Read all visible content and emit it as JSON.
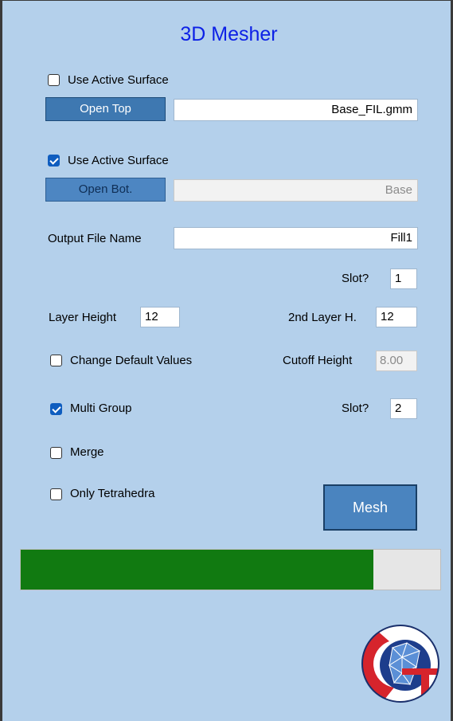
{
  "title": "3D Mesher",
  "top_surface": {
    "use_active_label": "Use Active Surface",
    "use_active_checked": false,
    "open_button": "Open Top",
    "file_value": "Base_FIL.gmm"
  },
  "bottom_surface": {
    "use_active_label": "Use Active Surface",
    "use_active_checked": true,
    "open_button": "Open Bot.",
    "file_value": "Base"
  },
  "output": {
    "label": "Output File Name",
    "value": "Fill1",
    "slot_label": "Slot?",
    "slot_value": "1"
  },
  "layers": {
    "layer_height_label": "Layer Height",
    "layer_height_value": "12",
    "second_layer_label": "2nd Layer H.",
    "second_layer_value": "12"
  },
  "defaults": {
    "change_label": "Change Default Values",
    "change_checked": false,
    "cutoff_label": "Cutoff Height",
    "cutoff_value": "8.00"
  },
  "multi_group": {
    "label": "Multi Group",
    "checked": true,
    "slot_label": "Slot?",
    "slot_value": "2"
  },
  "merge": {
    "label": "Merge",
    "checked": false
  },
  "tetra": {
    "label": "Only Tetrahedra",
    "checked": false
  },
  "mesh_button": "Mesh",
  "progress_fraction": 0.84,
  "colors": {
    "title": "#0d21e6",
    "panel_bg": "#b4d0eb",
    "button": "#3e78b1",
    "progress_fill": "#117a11",
    "checkbox_on": "#0f5dbf"
  }
}
